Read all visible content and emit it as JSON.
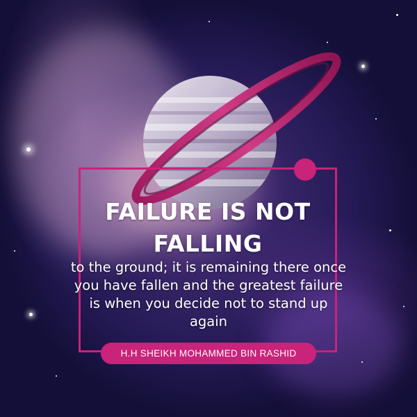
{
  "quote": {
    "headline": "FAILURE IS NOT FALLING",
    "body": "to the ground; it is remaining there once you have fallen and the greatest failure is when you decide not to stand up again",
    "author": "H.H SHEIKH MOHAMMED BIN RASHID"
  },
  "colors": {
    "accent": "#c9237a",
    "text": "#ffffff",
    "background": "#241a55"
  },
  "illustration": {
    "subject": "ringed-planet-icon"
  }
}
